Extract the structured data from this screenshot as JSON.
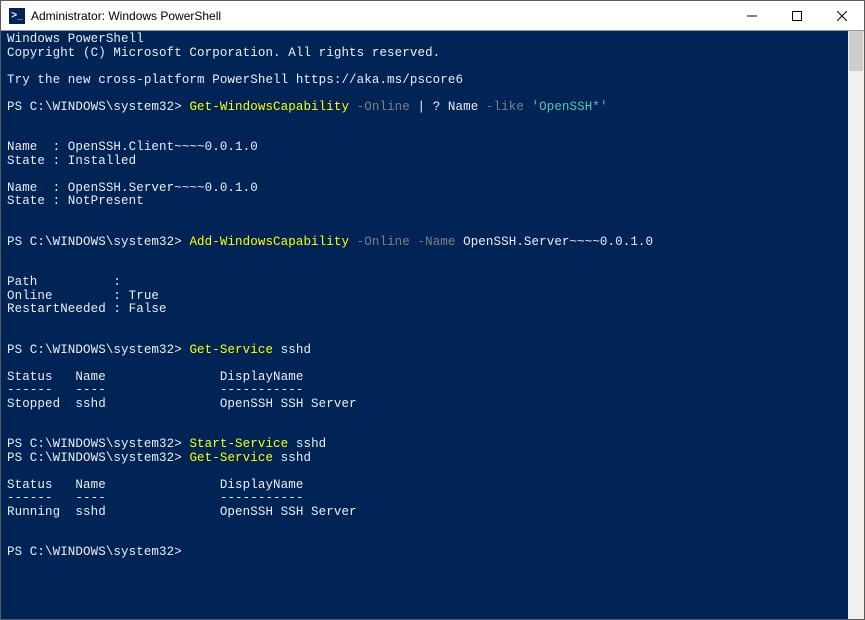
{
  "titlebar": {
    "icon_glyph": ">_",
    "title": "Administrator: Windows PowerShell"
  },
  "terminal": {
    "intro_line1": "Windows PowerShell",
    "intro_line2": "Copyright (C) Microsoft Corporation. All rights reserved.",
    "intro_line3": "Try the new cross-platform PowerShell https://aka.ms/pscore6",
    "prompt": "PS C:\\WINDOWS\\system32> ",
    "cmd1": {
      "verb": "Get-WindowsCapability",
      "p1": " -Online ",
      "pipe": "| ? ",
      "name_lbl": "Name ",
      "like": "-like ",
      "pattern": "'OpenSSH*'"
    },
    "cmd1_out": "\n\nName  : OpenSSH.Client~~~~0.0.1.0\nState : Installed\n\nName  : OpenSSH.Server~~~~0.0.1.0\nState : NotPresent\n\n",
    "cmd2": {
      "verb": "Add-WindowsCapability",
      "p1": " -Online -Name ",
      "arg": "OpenSSH.Server~~~~0.0.1.0"
    },
    "cmd2_out": "\n\nPath          :\nOnline        : True\nRestartNeeded : False\n\n\n",
    "cmd3": {
      "verb": "Get-Service",
      "arg": " sshd"
    },
    "cmd3_out": "\nStatus   Name               DisplayName\n------   ----               -----------\nStopped  sshd               OpenSSH SSH Server\n\n",
    "cmd4": {
      "verb": "Start-Service",
      "arg": " sshd"
    },
    "cmd5": {
      "verb": "Get-Service",
      "arg": " sshd"
    },
    "cmd5_out": "\nStatus   Name               DisplayName\n------   ----               -----------\nRunning  sshd               OpenSSH SSH Server\n\n"
  }
}
